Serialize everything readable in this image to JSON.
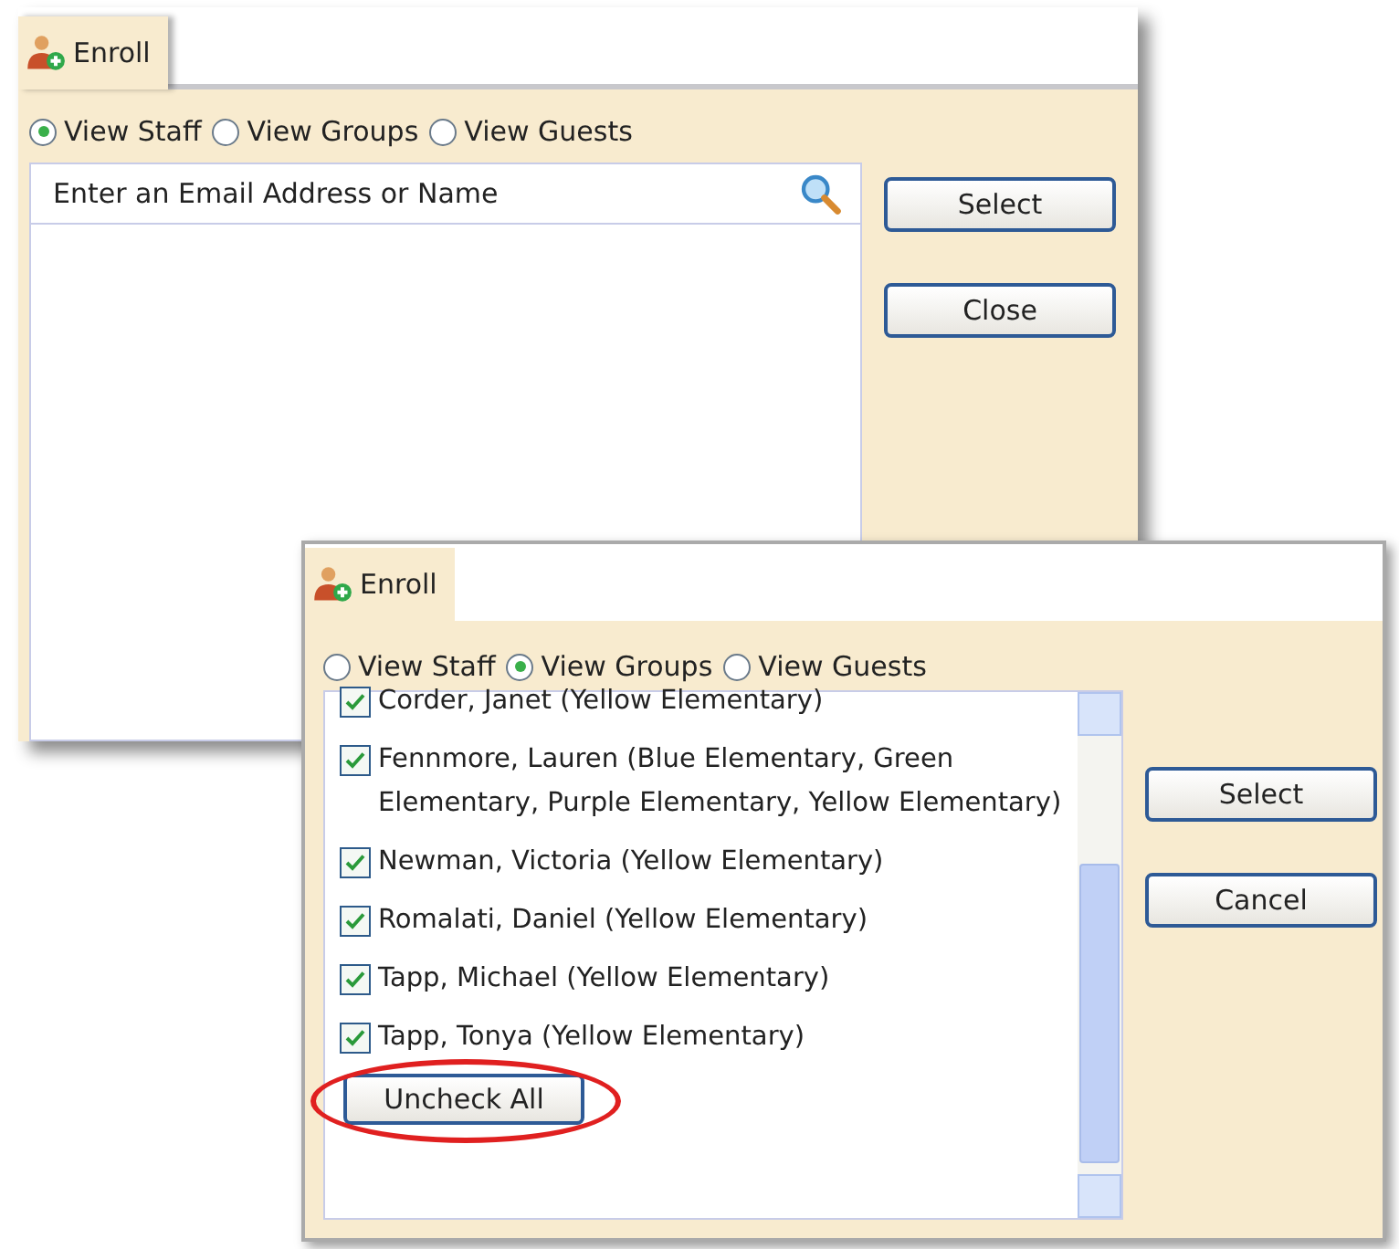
{
  "windows": [
    {
      "tab": {
        "label": "Enroll"
      },
      "view_options": [
        {
          "label": "View Staff",
          "selected": true
        },
        {
          "label": "View Groups",
          "selected": false
        },
        {
          "label": "View Guests",
          "selected": false
        }
      ],
      "search": {
        "placeholder": "Enter an Email Address or Name"
      },
      "buttons": [
        "Select",
        "Close"
      ]
    },
    {
      "tab": {
        "label": "Enroll"
      },
      "view_options": [
        {
          "label": "View Staff",
          "selected": false
        },
        {
          "label": "View Groups",
          "selected": true
        },
        {
          "label": "View Guests",
          "selected": false
        }
      ],
      "members": [
        {
          "name": "Corder, Janet (Yellow Elementary)",
          "checked": true
        },
        {
          "name": "Fennmore, Lauren (Blue Elementary, Green Elementary, Purple Elementary, Yellow Elementary)",
          "checked": true
        },
        {
          "name": "Newman, Victoria (Yellow Elementary)",
          "checked": true
        },
        {
          "name": "Romalati, Daniel (Yellow Elementary)",
          "checked": true
        },
        {
          "name": "Tapp, Michael (Yellow Elementary)",
          "checked": true
        },
        {
          "name": "Tapp, Tonya (Yellow Elementary)",
          "checked": true
        }
      ],
      "list_button": {
        "label": "Uncheck All",
        "highlighted": true
      },
      "buttons": [
        "Select",
        "Cancel"
      ]
    }
  ]
}
